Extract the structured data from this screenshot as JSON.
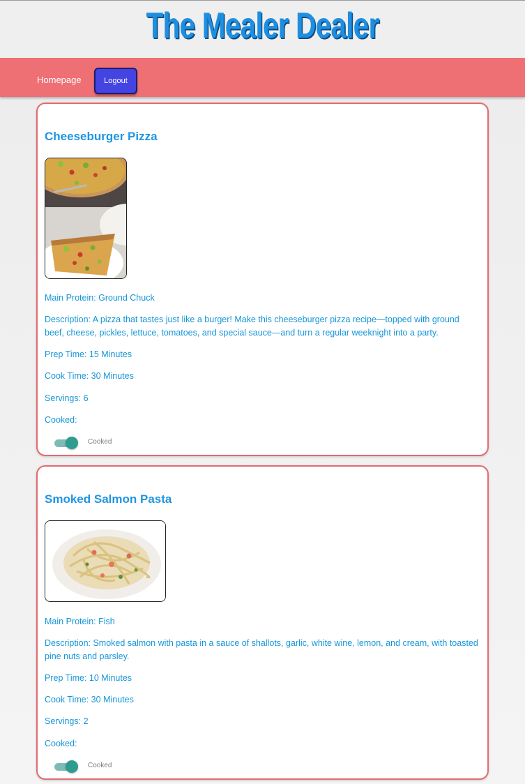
{
  "header": {
    "title": "The Mealer Dealer"
  },
  "nav": {
    "home_label": "Homepage",
    "logout_label": "Logout"
  },
  "recipes": [
    {
      "title": "Cheeseburger Pizza",
      "image": "cheeseburger-pizza-photo",
      "main_protein": "Main Protein: Ground Chuck",
      "description": "Description: A pizza that tastes just like a burger! Make this cheeseburger pizza recipe—topped with ground beef, cheese, pickles, lettuce, tomatoes, and special sauce—and turn a regular weeknight into a party.",
      "prep_time": "Prep Time: 15 Minutes",
      "cook_time": "Cook Time: 30 Minutes",
      "servings": "Servings: 6",
      "cooked_label": "Cooked:",
      "toggle_label": "Cooked",
      "cooked": true
    },
    {
      "title": "Smoked Salmon Pasta",
      "image": "smoked-salmon-pasta-photo",
      "main_protein": "Main Protein: Fish",
      "description": "Description: Smoked salmon with pasta in a sauce of shallots, garlic, white wine, lemon, and cream, with toasted pine nuts and parsley.",
      "prep_time": "Prep Time: 10 Minutes",
      "cook_time": "Cook Time: 30 Minutes",
      "servings": "Servings: 2",
      "cooked_label": "Cooked:",
      "toggle_label": "Cooked",
      "cooked": true
    }
  ],
  "colors": {
    "accent": "#ee7075",
    "title_blue": "#1e8fe0",
    "text_blue": "#1596d8",
    "logout_button": "#4444e2",
    "toggle_on": "#2e9c8f"
  }
}
